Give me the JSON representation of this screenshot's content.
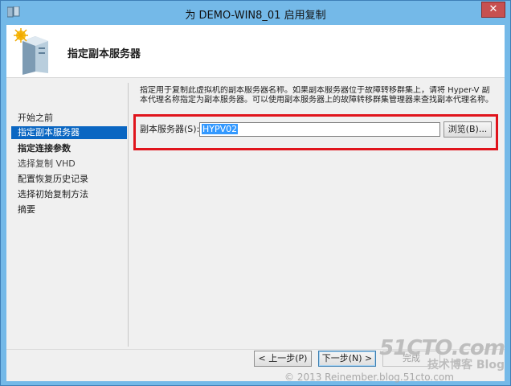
{
  "window": {
    "title": "为 DEMO-WIN8_01 启用复制",
    "close_glyph": "✕"
  },
  "header": {
    "title": "指定副本服务器"
  },
  "nav": {
    "items": [
      {
        "label": "开始之前"
      },
      {
        "label": "指定副本服务器"
      },
      {
        "label": "指定连接参数"
      },
      {
        "label": "选择复制 VHD"
      },
      {
        "label": "配置恢复历史记录"
      },
      {
        "label": "选择初始复制方法"
      },
      {
        "label": "摘要"
      }
    ]
  },
  "main": {
    "description": "指定用于复制此虚拟机的副本服务器名称。如果副本服务器位于故障转移群集上，请将 Hyper-V 副本代理名称指定为副本服务器。可以使用副本服务器上的故障转移群集管理器来查找副本代理名称。",
    "replica_label": "副本服务器(S):",
    "replica_value": "HYPV02",
    "browse_label": "浏览(B)..."
  },
  "footer": {
    "prev_label": "< 上一步(P)",
    "next_label": "下一步(N) >",
    "finish_label": "完成"
  },
  "watermark": {
    "logo": "51CTO.com",
    "sub": "技术博客",
    "blog": "Blog",
    "copyright": "© 2013 Reinember.blog.51cto.com"
  },
  "colors": {
    "title_bar": "#74b9e8",
    "selection": "#0a66c2",
    "highlight_border": "#e0141c"
  }
}
